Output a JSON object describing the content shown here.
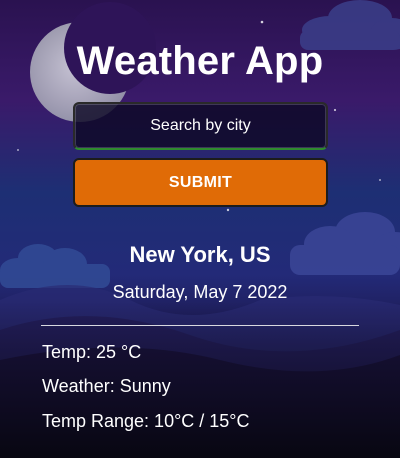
{
  "app": {
    "title": "Weather App"
  },
  "search": {
    "value": "",
    "placeholder": "Search by city"
  },
  "submit": {
    "label": "SUBMIT"
  },
  "location": {
    "city": "New York, US",
    "date": "Saturday, May 7 2022"
  },
  "details": {
    "temp": "Temp: 25 °C",
    "weather": "Weather: Sunny",
    "temp_range": "Temp Range: 10°C / 15°C"
  },
  "colors": {
    "accent": "#e06b06",
    "text": "#ffffff",
    "background_top": "#2a1250",
    "background_bottom": "#0c0a1c"
  },
  "icons": {
    "background": "moon-night-sky-illustration"
  }
}
